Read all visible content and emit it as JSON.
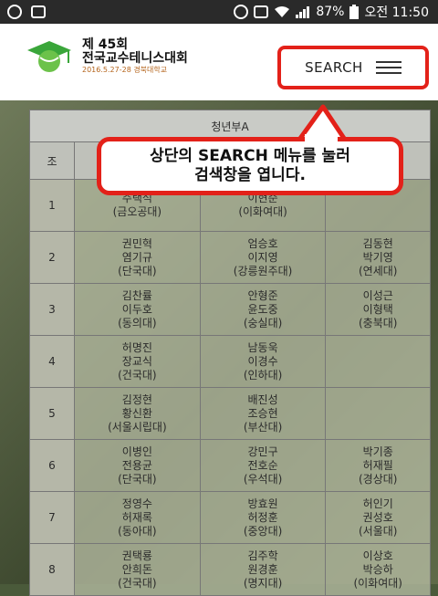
{
  "status_bar": {
    "battery": "87%",
    "time": "오전 11:50",
    "icons": [
      "usb-icon",
      "image-icon",
      "alarm-icon",
      "hd-icon",
      "wifi-icon",
      "signal-icon",
      "battery-icon"
    ]
  },
  "header": {
    "logo_line1": "제 45회",
    "logo_line2": "전국교수테니스대회",
    "logo_line3": "2016.5.27-28 경북대학교",
    "search_label": "SEARCH"
  },
  "callout": {
    "line1": "상단의 SEARCH 메뉴를 눌러",
    "line2": "검색창을 엽니다."
  },
  "table": {
    "caption": "청년부A",
    "group_header": "조",
    "rows": [
      {
        "group": "1",
        "cells": [
          [
            "주택석",
            "(금오공대)"
          ],
          [
            "이현준",
            "(이화여대)"
          ],
          []
        ]
      },
      {
        "group": "2",
        "cells": [
          [
            "권민혁",
            "염기규",
            "(단국대)"
          ],
          [
            "엄승호",
            "이지영",
            "(강릉원주대)"
          ],
          [
            "김동현",
            "박기영",
            "(연세대)"
          ]
        ]
      },
      {
        "group": "3",
        "cells": [
          [
            "김찬률",
            "이두호",
            "(동의대)"
          ],
          [
            "안형준",
            "윤도중",
            "(숭실대)"
          ],
          [
            "이성근",
            "이형택",
            "(충북대)"
          ]
        ]
      },
      {
        "group": "4",
        "cells": [
          [
            "허명진",
            "장교식",
            "(건국대)"
          ],
          [
            "남동욱",
            "이경수",
            "(인하대)"
          ],
          []
        ]
      },
      {
        "group": "5",
        "cells": [
          [
            "김정현",
            "황신환",
            "(서울시립대)"
          ],
          [
            "배진성",
            "조승현",
            "(부산대)"
          ],
          []
        ]
      },
      {
        "group": "6",
        "cells": [
          [
            "이병인",
            "전용균",
            "(단국대)"
          ],
          [
            "강민구",
            "전호순",
            "(우석대)"
          ],
          [
            "박기종",
            "허재필",
            "(경상대)"
          ]
        ]
      },
      {
        "group": "7",
        "cells": [
          [
            "정영수",
            "허재록",
            "(동아대)"
          ],
          [
            "방효원",
            "허정훈",
            "(중앙대)"
          ],
          [
            "허인기",
            "권성호",
            "(서울대)"
          ]
        ]
      },
      {
        "group": "8",
        "cells": [
          [
            "권택룡",
            "안희돈",
            "(건국대)"
          ],
          [
            "김주학",
            "원경훈",
            "(명지대)"
          ],
          [
            "이상호",
            "박승하",
            "(이화여대)"
          ]
        ]
      }
    ]
  },
  "colors": {
    "accent_red": "#e32119",
    "header_bg": "#ffffff",
    "logo_green": "#3aa63a",
    "date_orange": "#b5651d"
  }
}
